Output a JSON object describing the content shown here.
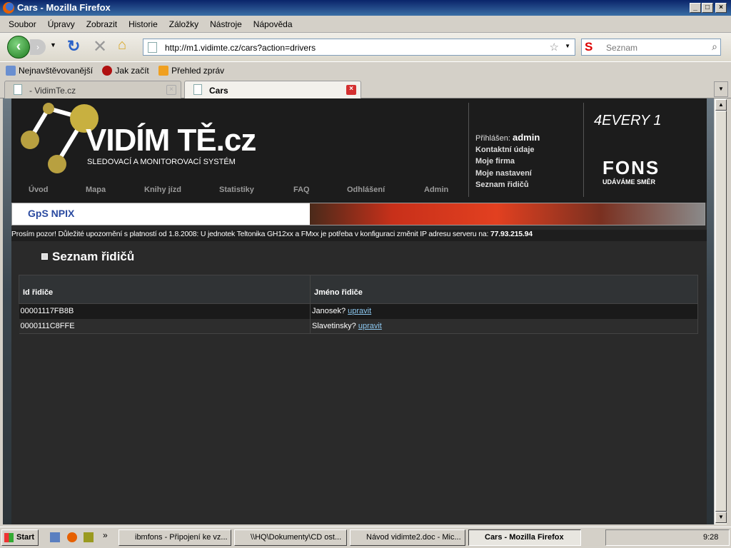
{
  "window": {
    "title": "Cars - Mozilla Firefox"
  },
  "menu": [
    "Soubor",
    "Úpravy",
    "Zobrazit",
    "Historie",
    "Záložky",
    "Nástroje",
    "Nápověda"
  ],
  "url": "http://m1.vidimte.cz/cars?action=drivers",
  "search": {
    "placeholder": "Seznam"
  },
  "bookmarks": [
    "Nejnavštěvovanější",
    "Jak začít",
    "Přehled zpráv"
  ],
  "tabs": [
    {
      "label": "- VidimTe.cz"
    },
    {
      "label": "Cars"
    }
  ],
  "site": {
    "logo": "VIDÍM TĚ.cz",
    "tagline": "SLEDOVACÍ A MONITOROVACÍ SYSTÉM",
    "nav": [
      "Úvod",
      "Mapa",
      "Knihy jízd",
      "Statistiky",
      "FAQ",
      "Odhlášení",
      "Admin"
    ],
    "logged_label": "Přihlášen:",
    "user": "admin",
    "links": [
      "Kontaktní údaje",
      "Moje firma",
      "Moje nastavení",
      "Seznam řidičů"
    ],
    "partner1": "4EVERY 1",
    "partner2": "FONS",
    "partner2_tag": "UDÁVÁME SMĚR",
    "banner_logo": "GpS NPIX",
    "notice": "Prosím pozor! Důležité upozornění s platností od 1.8.2008: U jednotek Teltonika GH12xx a FMxx je potřeba v konfiguraci změnit IP adresu serveru na: ",
    "notice_ip": "77.93.215.94"
  },
  "content": {
    "title": "Seznam řidičů",
    "columns": [
      "Id řidiče",
      "Jméno řidiče"
    ],
    "rows": [
      {
        "id": "00001117FB8B",
        "name": "Janosek?",
        "action": "upravit"
      },
      {
        "id": "0000111C8FFE",
        "name": "Slavetinsky?",
        "action": "upravit"
      }
    ]
  },
  "taskbar": {
    "start": "Start",
    "items": [
      "ibmfons - Připojení ke vz...",
      "\\\\HQ\\Dokumenty\\CD ost...",
      "Návod vidimte2.doc - Mic...",
      "Cars - Mozilla Firefox"
    ],
    "clock": "9:28"
  }
}
